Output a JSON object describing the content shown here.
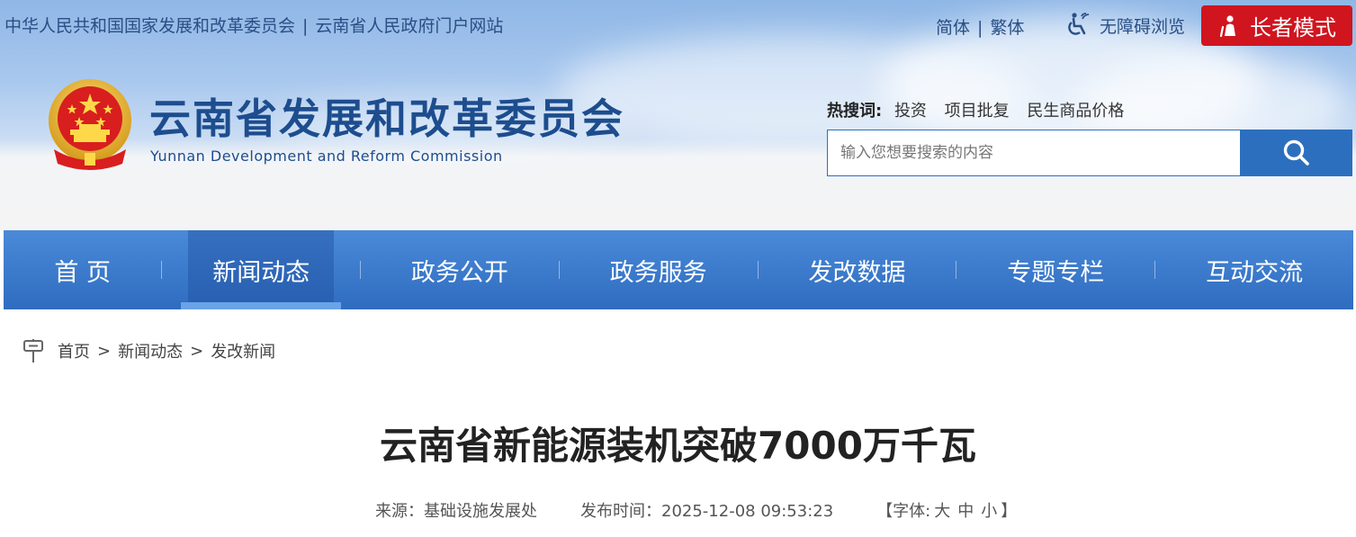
{
  "top_links": {
    "ndrc": "中华人民共和国国家发展和改革委员会",
    "separator": "|",
    "yunnan_gov": "云南省人民政府门户网站"
  },
  "lang": {
    "simplified": "简体",
    "separator": "|",
    "traditional": "繁体"
  },
  "accessibility": {
    "label": "无障碍浏览",
    "icon": "wheelchair-icon"
  },
  "elder_mode": {
    "label": "长者模式",
    "icon": "elder-person-icon",
    "color": "#d0151f"
  },
  "site": {
    "title": "云南省发展和改革委员会",
    "subtitle": "Yunnan Development and Reform Commission",
    "emblem": "national-emblem-icon"
  },
  "hot_search": {
    "label": "热搜词:",
    "items": [
      "投资",
      "项目批复",
      "民生商品价格"
    ]
  },
  "search": {
    "placeholder": "输入您想要搜索的内容",
    "button_icon": "search-icon",
    "accent": "#2d6fbf"
  },
  "nav": {
    "items": [
      "首 页",
      "新闻动态",
      "政务公开",
      "政务服务",
      "发改数据",
      "专题专栏",
      "互动交流"
    ],
    "active_index": 1
  },
  "breadcrumb": {
    "icon": "location-pin-icon",
    "items": [
      "首页",
      "新闻动态",
      "发改新闻"
    ],
    "separator": ">"
  },
  "article": {
    "title": "云南省新能源装机突破7000万千瓦",
    "source": "来源：基础设施发展处",
    "publish_time": "发布时间：2025-12-08 09:53:23",
    "font_size_prefix": "【字体:",
    "font_size_options": [
      "大",
      "中",
      "小"
    ],
    "font_size_suffix": "】"
  }
}
